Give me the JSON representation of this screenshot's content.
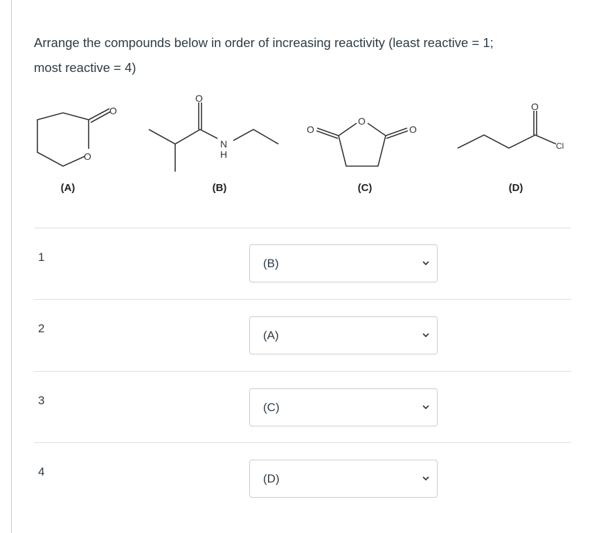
{
  "question": {
    "line1": "Arrange the compounds below in order of increasing reactivity (least reactive = 1;",
    "line2": "most reactive = 4)"
  },
  "compounds": [
    {
      "label": "(A)",
      "name": "delta-valerolactone",
      "atoms": [
        "O",
        "O"
      ]
    },
    {
      "label": "(B)",
      "name": "N-ethyl-2-methylpropanamide",
      "atoms": [
        "O",
        "N",
        "H"
      ]
    },
    {
      "label": "(C)",
      "name": "succinic anhydride",
      "atoms": [
        "O",
        "O",
        "O"
      ]
    },
    {
      "label": "(D)",
      "name": "butanoyl chloride",
      "atoms": [
        "O",
        "Cl"
      ]
    }
  ],
  "rows": [
    {
      "rank": "1",
      "selected": "(B)"
    },
    {
      "rank": "2",
      "selected": "(A)"
    },
    {
      "rank": "3",
      "selected": "(C)"
    },
    {
      "rank": "4",
      "selected": "(D)"
    }
  ],
  "icons": {
    "dropdown": "chevron-down-icon"
  }
}
